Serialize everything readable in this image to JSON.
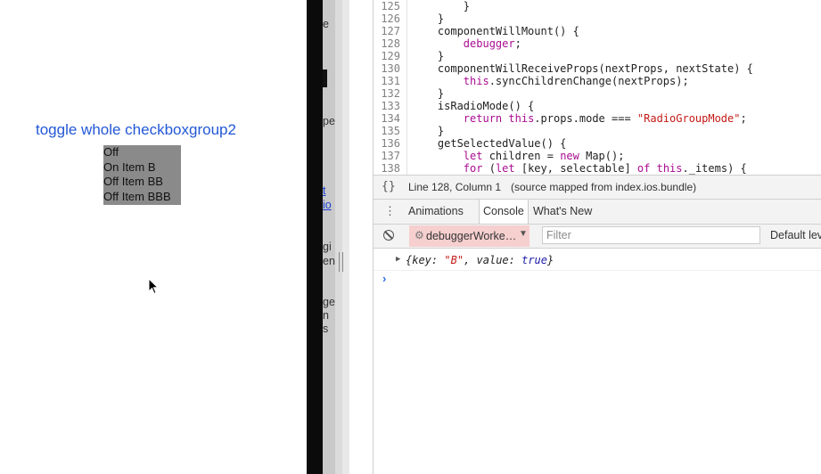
{
  "simulator": {
    "toggle_link": "toggle whole checkboxgroup2",
    "checkbox_rows": [
      "Off",
      "On  Item B",
      "Off  Item BB",
      "Off  Item BBB"
    ]
  },
  "middle_fragments": [
    "e",
    "pe",
    "t",
    "io",
    "gi",
    "en",
    "ge",
    "n",
    "s"
  ],
  "code": {
    "lines": [
      {
        "n": "125",
        "text": "        }"
      },
      {
        "n": "126",
        "text": "    }"
      },
      {
        "n": "127",
        "text": "    componentWillMount() {"
      },
      {
        "n": "128",
        "text": "        debugger;"
      },
      {
        "n": "129",
        "text": "    }"
      },
      {
        "n": "130",
        "text": "    componentWillReceiveProps(nextProps, nextState) {"
      },
      {
        "n": "131",
        "text": "        this.syncChildrenChange(nextProps);"
      },
      {
        "n": "132",
        "text": "    }"
      },
      {
        "n": "133",
        "text": "    isRadioMode() {"
      },
      {
        "n": "134",
        "text": "        return this.props.mode === \"RadioGroupMode\";"
      },
      {
        "n": "135",
        "text": "    }"
      },
      {
        "n": "136",
        "text": "    getSelectedValue() {"
      },
      {
        "n": "137",
        "text": "        let children = new Map();"
      },
      {
        "n": "138",
        "text": "        for (let [key, selectable] of this._items) {"
      }
    ]
  },
  "status": {
    "brace_icon": "{}",
    "position": "Line 128, Column 1",
    "source_mapped": "(source mapped from index.ios.bundle)"
  },
  "drawer": {
    "menu_icon": "⋮",
    "tabs": [
      "Animations",
      "Console",
      "What's New"
    ],
    "active_tab": "Console"
  },
  "console_toolbar": {
    "context": "debuggerWorke…",
    "filter_placeholder": "Filter",
    "levels": "Default levels"
  },
  "console_output": {
    "entry": "{key: \"B\", value: true}",
    "prompt": "›"
  },
  "icons": {
    "cursor": "arrow-pointer",
    "clear": "block-icon",
    "gear": "gear-icon",
    "expand": "triangle-right-icon"
  },
  "colors": {
    "link": "#2358d6",
    "checkbox_bg": "#8a8a8a",
    "context_bg": "#f6cfcf",
    "keyword": "#aa0d91",
    "string": "#c41a16"
  }
}
